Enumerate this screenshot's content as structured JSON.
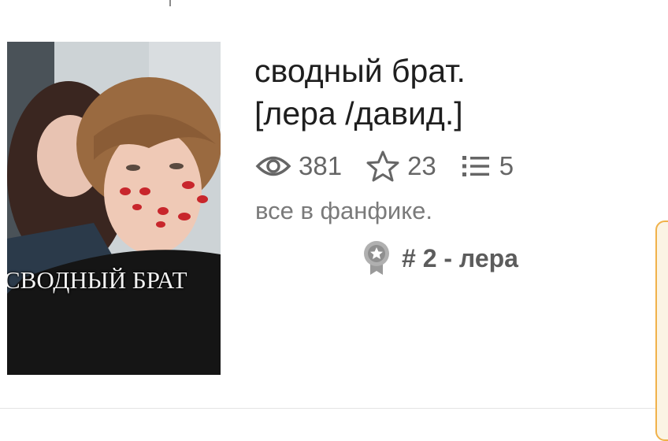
{
  "story": {
    "title_line1": "сводный брат.",
    "title_line2": "[лера /давид.]",
    "cover_caption": "СВОДНЫЙ БРАТ",
    "stats": {
      "views": "381",
      "votes": "23",
      "parts": "5",
      "views_icon": "eye-icon",
      "votes_icon": "star-icon",
      "parts_icon": "list-icon"
    },
    "description": "все в фанфике.",
    "ranking": {
      "text": "# 2 - лера",
      "icon": "ranking-badge-icon"
    }
  },
  "colors": {
    "accent_tab_border": "#f0b24a",
    "text_dark": "#1e1e1e",
    "text_muted": "#666666"
  }
}
